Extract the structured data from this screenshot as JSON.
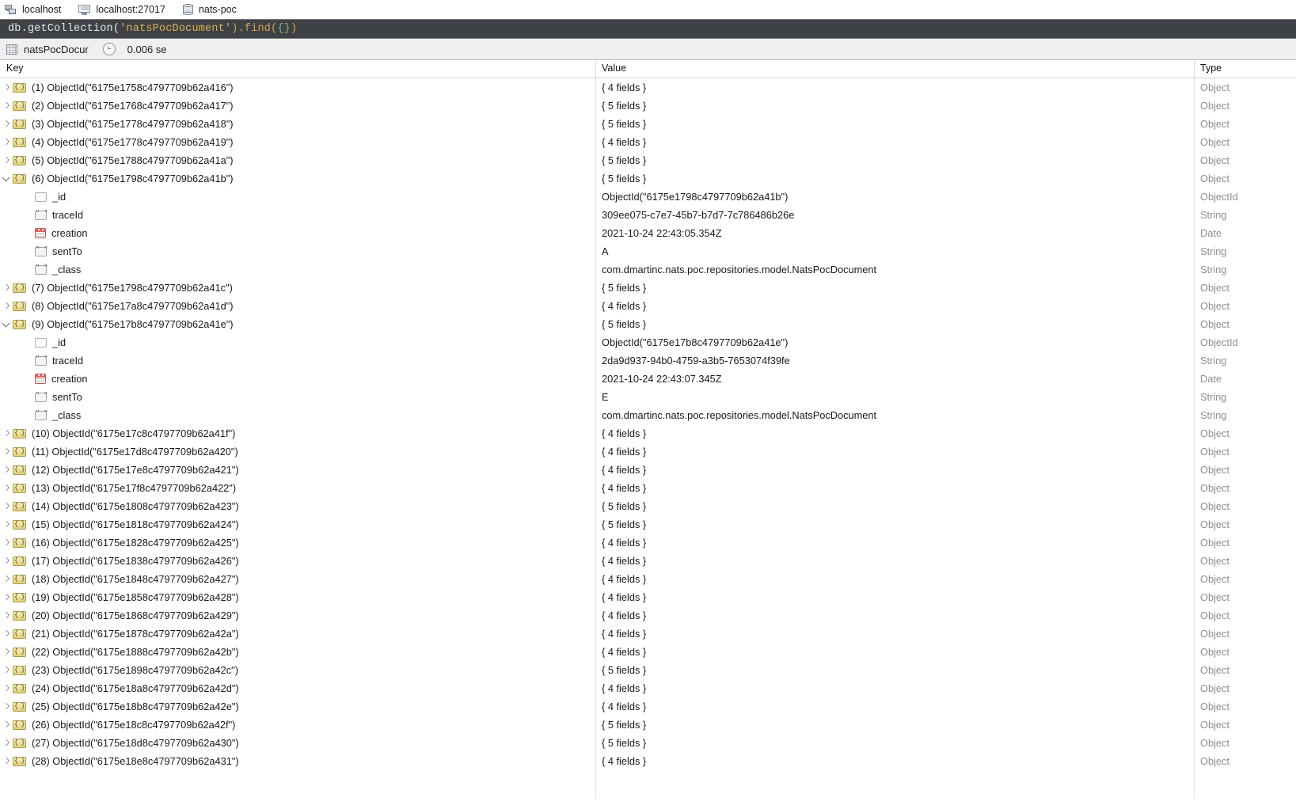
{
  "breadcrumb": {
    "items": [
      {
        "label": "localhost",
        "icon": "server-icon"
      },
      {
        "label": "localhost:27017",
        "icon": "monitor-icon"
      },
      {
        "label": "nats-poc",
        "icon": "database-icon"
      }
    ]
  },
  "query_bar": {
    "prefix": "db.getCollection(",
    "string_arg": "'natsPocDocument'",
    "mid": ").find(",
    "braces": "{}",
    "suffix": ")",
    "full_text": "db.getCollection('natsPocDocument').find({})",
    "colors": {
      "background": "#3e4246",
      "plain": "#e8e8e8",
      "string": "#e0b050",
      "paren": "#d6a24a",
      "brace": "#7fb069"
    }
  },
  "result_tab": {
    "collection_label": "natsPocDocur",
    "elapsed_label": "0.006 se",
    "grid_icon": "grid-icon",
    "clock_icon": "clock-icon"
  },
  "columns": {
    "key": "Key",
    "value": "Value",
    "type": "Type"
  },
  "rows": [
    {
      "level": 0,
      "state": "collapsed",
      "icon": "object-icon",
      "key": "(1) ObjectId(\"6175e1758c4797709b62a416\")",
      "value": "{ 4 fields }",
      "type": "Object"
    },
    {
      "level": 0,
      "state": "collapsed",
      "icon": "object-icon",
      "key": "(2) ObjectId(\"6175e1768c4797709b62a417\")",
      "value": "{ 5 fields }",
      "type": "Object"
    },
    {
      "level": 0,
      "state": "collapsed",
      "icon": "object-icon",
      "key": "(3) ObjectId(\"6175e1778c4797709b62a418\")",
      "value": "{ 5 fields }",
      "type": "Object"
    },
    {
      "level": 0,
      "state": "collapsed",
      "icon": "object-icon",
      "key": "(4) ObjectId(\"6175e1778c4797709b62a419\")",
      "value": "{ 4 fields }",
      "type": "Object"
    },
    {
      "level": 0,
      "state": "collapsed",
      "icon": "object-icon",
      "key": "(5) ObjectId(\"6175e1788c4797709b62a41a\")",
      "value": "{ 5 fields }",
      "type": "Object"
    },
    {
      "level": 0,
      "state": "expanded",
      "icon": "object-icon",
      "key": "(6) ObjectId(\"6175e1798c4797709b62a41b\")",
      "value": "{ 5 fields }",
      "type": "Object"
    },
    {
      "level": 1,
      "state": "leaf",
      "icon": "objectid-icon",
      "key": "_id",
      "value": "ObjectId(\"6175e1798c4797709b62a41b\")",
      "type": "ObjectId"
    },
    {
      "level": 1,
      "state": "leaf",
      "icon": "string-icon",
      "key": "traceId",
      "value": "309ee075-c7e7-45b7-b7d7-7c786486b26e",
      "type": "String"
    },
    {
      "level": 1,
      "state": "leaf",
      "icon": "date-icon",
      "key": "creation",
      "value": "2021-10-24 22:43:05.354Z",
      "type": "Date"
    },
    {
      "level": 1,
      "state": "leaf",
      "icon": "string-icon",
      "key": "sentTo",
      "value": "A",
      "type": "String"
    },
    {
      "level": 1,
      "state": "leaf",
      "icon": "string-icon",
      "key": "_class",
      "value": "com.dmartinc.nats.poc.repositories.model.NatsPocDocument",
      "type": "String"
    },
    {
      "level": 0,
      "state": "collapsed",
      "icon": "object-icon",
      "key": "(7) ObjectId(\"6175e1798c4797709b62a41c\")",
      "value": "{ 5 fields }",
      "type": "Object"
    },
    {
      "level": 0,
      "state": "collapsed",
      "icon": "object-icon",
      "key": "(8) ObjectId(\"6175e17a8c4797709b62a41d\")",
      "value": "{ 4 fields }",
      "type": "Object"
    },
    {
      "level": 0,
      "state": "expanded",
      "icon": "object-icon",
      "key": "(9) ObjectId(\"6175e17b8c4797709b62a41e\")",
      "value": "{ 5 fields }",
      "type": "Object"
    },
    {
      "level": 1,
      "state": "leaf",
      "icon": "objectid-icon",
      "key": "_id",
      "value": "ObjectId(\"6175e17b8c4797709b62a41e\")",
      "type": "ObjectId"
    },
    {
      "level": 1,
      "state": "leaf",
      "icon": "string-icon",
      "key": "traceId",
      "value": "2da9d937-94b0-4759-a3b5-7653074f39fe",
      "type": "String"
    },
    {
      "level": 1,
      "state": "leaf",
      "icon": "date-icon",
      "key": "creation",
      "value": "2021-10-24 22:43:07.345Z",
      "type": "Date"
    },
    {
      "level": 1,
      "state": "leaf",
      "icon": "string-icon",
      "key": "sentTo",
      "value": "E",
      "type": "String"
    },
    {
      "level": 1,
      "state": "leaf",
      "icon": "string-icon",
      "key": "_class",
      "value": "com.dmartinc.nats.poc.repositories.model.NatsPocDocument",
      "type": "String"
    },
    {
      "level": 0,
      "state": "collapsed",
      "icon": "object-icon",
      "key": "(10) ObjectId(\"6175e17c8c4797709b62a41f\")",
      "value": "{ 4 fields }",
      "type": "Object"
    },
    {
      "level": 0,
      "state": "collapsed",
      "icon": "object-icon",
      "key": "(11) ObjectId(\"6175e17d8c4797709b62a420\")",
      "value": "{ 4 fields }",
      "type": "Object"
    },
    {
      "level": 0,
      "state": "collapsed",
      "icon": "object-icon",
      "key": "(12) ObjectId(\"6175e17e8c4797709b62a421\")",
      "value": "{ 4 fields }",
      "type": "Object"
    },
    {
      "level": 0,
      "state": "collapsed",
      "icon": "object-icon",
      "key": "(13) ObjectId(\"6175e17f8c4797709b62a422\")",
      "value": "{ 4 fields }",
      "type": "Object"
    },
    {
      "level": 0,
      "state": "collapsed",
      "icon": "object-icon",
      "key": "(14) ObjectId(\"6175e1808c4797709b62a423\")",
      "value": "{ 5 fields }",
      "type": "Object"
    },
    {
      "level": 0,
      "state": "collapsed",
      "icon": "object-icon",
      "key": "(15) ObjectId(\"6175e1818c4797709b62a424\")",
      "value": "{ 5 fields }",
      "type": "Object"
    },
    {
      "level": 0,
      "state": "collapsed",
      "icon": "object-icon",
      "key": "(16) ObjectId(\"6175e1828c4797709b62a425\")",
      "value": "{ 4 fields }",
      "type": "Object"
    },
    {
      "level": 0,
      "state": "collapsed",
      "icon": "object-icon",
      "key": "(17) ObjectId(\"6175e1838c4797709b62a426\")",
      "value": "{ 4 fields }",
      "type": "Object"
    },
    {
      "level": 0,
      "state": "collapsed",
      "icon": "object-icon",
      "key": "(18) ObjectId(\"6175e1848c4797709b62a427\")",
      "value": "{ 4 fields }",
      "type": "Object"
    },
    {
      "level": 0,
      "state": "collapsed",
      "icon": "object-icon",
      "key": "(19) ObjectId(\"6175e1858c4797709b62a428\")",
      "value": "{ 4 fields }",
      "type": "Object"
    },
    {
      "level": 0,
      "state": "collapsed",
      "icon": "object-icon",
      "key": "(20) ObjectId(\"6175e1868c4797709b62a429\")",
      "value": "{ 4 fields }",
      "type": "Object"
    },
    {
      "level": 0,
      "state": "collapsed",
      "icon": "object-icon",
      "key": "(21) ObjectId(\"6175e1878c4797709b62a42a\")",
      "value": "{ 4 fields }",
      "type": "Object"
    },
    {
      "level": 0,
      "state": "collapsed",
      "icon": "object-icon",
      "key": "(22) ObjectId(\"6175e1888c4797709b62a42b\")",
      "value": "{ 4 fields }",
      "type": "Object"
    },
    {
      "level": 0,
      "state": "collapsed",
      "icon": "object-icon",
      "key": "(23) ObjectId(\"6175e1898c4797709b62a42c\")",
      "value": "{ 5 fields }",
      "type": "Object"
    },
    {
      "level": 0,
      "state": "collapsed",
      "icon": "object-icon",
      "key": "(24) ObjectId(\"6175e18a8c4797709b62a42d\")",
      "value": "{ 4 fields }",
      "type": "Object"
    },
    {
      "level": 0,
      "state": "collapsed",
      "icon": "object-icon",
      "key": "(25) ObjectId(\"6175e18b8c4797709b62a42e\")",
      "value": "{ 4 fields }",
      "type": "Object"
    },
    {
      "level": 0,
      "state": "collapsed",
      "icon": "object-icon",
      "key": "(26) ObjectId(\"6175e18c8c4797709b62a42f\")",
      "value": "{ 5 fields }",
      "type": "Object"
    },
    {
      "level": 0,
      "state": "collapsed",
      "icon": "object-icon",
      "key": "(27) ObjectId(\"6175e18d8c4797709b62a430\")",
      "value": "{ 5 fields }",
      "type": "Object"
    },
    {
      "level": 0,
      "state": "collapsed",
      "icon": "object-icon",
      "key": "(28) ObjectId(\"6175e18e8c4797709b62a431\")",
      "value": "{ 4 fields }",
      "type": "Object"
    }
  ]
}
